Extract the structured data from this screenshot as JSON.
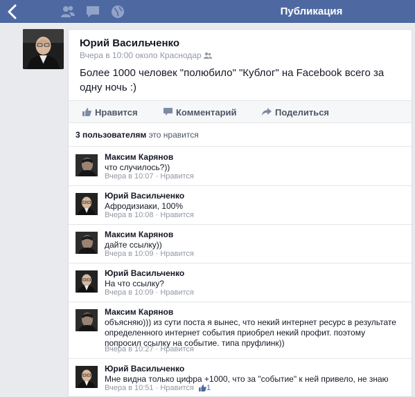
{
  "header": {
    "title": "Публикация",
    "back_icon": "chevron-left-icon",
    "icons": [
      "friends-icon",
      "messages-icon",
      "globe-icon"
    ],
    "color": "#4e69a2"
  },
  "post": {
    "author": "Юрий Васильченко",
    "meta": "Вчера в 10:00 около Краснодар",
    "text": "Более 1000 человек \"полюбило\" \"Кублог\" на Facebook всего за одну ночь :)",
    "actions": {
      "like": "Нравится",
      "comment": "Комментарий",
      "share": "Поделиться"
    },
    "likes": {
      "count_text": "3 пользователям",
      "suffix": " это нравится"
    }
  },
  "comments": [
    {
      "author": "Максим Карянов",
      "text": "что случилось?))",
      "time": "Вчера в 10:07",
      "sep": " · ",
      "like": "Нравится",
      "avatar": "max"
    },
    {
      "author": "Юрий Васильченко",
      "text": "Афродизиаки, 100%",
      "time": "Вчера в 10:08",
      "sep": " · ",
      "like": "Нравится",
      "avatar": "yuri"
    },
    {
      "author": "Максим Карянов",
      "text": "дайте ссылку))",
      "time": "Вчера в 10:09",
      "sep": " · ",
      "like": "Нравится",
      "avatar": "max"
    },
    {
      "author": "Юрий Васильченко",
      "text": "На что ссылку?",
      "time": "Вчера в 10:09",
      "sep": " · ",
      "like": "Нравится",
      "avatar": "yuri"
    },
    {
      "author": "Максим Карянов",
      "text": "объясняю))) из сути поста я вынес, что некий интернет ресурс в результате определенного интернет события приобрел некий профит. поэтому попросил ссылку на событие. типа пруфлинк))",
      "time": "Вчера в 10:27",
      "sep": " · ",
      "like": "Нравится",
      "avatar": "max"
    },
    {
      "author": "Юрий Васильченко",
      "text": "Мне видна только цифра +1000, что за \"событие\" к ней привело, не знаю",
      "time": "Вчера в 10:51",
      "sep": " · ",
      "like": "Нравится",
      "likes_count": "1",
      "avatar": "yuri"
    }
  ]
}
